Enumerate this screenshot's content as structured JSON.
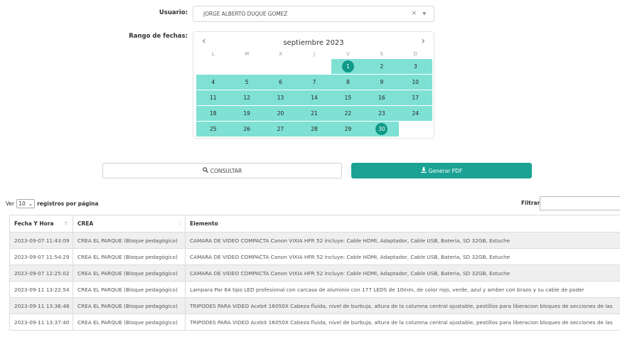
{
  "user_field": {
    "label": "Usuario:",
    "value": "JORGE ALBERTO DUQUE GOMEZ",
    "clear_icon": "close-icon",
    "caret_icon": "chevron-down-icon"
  },
  "date_range": {
    "label": "Rango de fechas:",
    "month_title": "septiembre 2023",
    "prev": "‹",
    "next": "›",
    "weekdays": [
      "L",
      "M",
      "X",
      "J",
      "V",
      "S",
      "D"
    ],
    "leading_blanks": 4,
    "days": [
      "1",
      "2",
      "3",
      "4",
      "5",
      "6",
      "7",
      "8",
      "9",
      "10",
      "11",
      "12",
      "13",
      "14",
      "15",
      "16",
      "17",
      "18",
      "19",
      "20",
      "21",
      "22",
      "23",
      "24",
      "25",
      "26",
      "27",
      "28",
      "29",
      "30"
    ],
    "range_start": "1",
    "range_end": "30"
  },
  "buttons": {
    "consult": "CONSULTAR",
    "consult_icon": "search-icon",
    "pdf": "Generar PDF",
    "pdf_icon": "download-icon"
  },
  "table_controls": {
    "show_prefix": "Ver",
    "page_size": "10",
    "show_suffix": "registros por página",
    "filter_label": "Filtrar"
  },
  "table": {
    "headers": [
      "Fecha Y Hora",
      "CREA",
      "Elemento"
    ],
    "rows": [
      [
        "2023-09-07 11:43:09",
        "CREA EL PARQUE (Bloque pedagógico)",
        "CAMARA DE VIDEO COMPACTA Canon VIXIA HFR 52 incluye: Cable HDMI, Adaptador, Cable USB, Bateria, SD 32GB, Estuche"
      ],
      [
        "2023-09-07 11:54:29",
        "CREA EL PARQUE (Bloque pedagógico)",
        "CAMARA DE VIDEO COMPACTA Canon VIXIA HFR 52 incluye: Cable HDMI, Adaptador, Cable USB, Bateria, SD 32GB, Estuche"
      ],
      [
        "2023-09-07 12:25:02",
        "CREA EL PARQUE (Bloque pedagógico)",
        "CAMARA DE VIDEO COMPACTA Canon VIXIA HFR 52 incluye: Cable HDMI, Adaptador, Cable USB, Bateria, SD 32GB, Estuche"
      ],
      [
        "2023-09-11 13:22:54",
        "CREA EL PARQUE (Bloque pedagógico)",
        "Lampara Par 64 tipo LED profesional con carcasa de aluminio con 177 LEDS de 10mm, de color rojo, verde, azul y amber con brazo y su cable de poder"
      ],
      [
        "2023-09-11 13:36:48",
        "CREA EL PARQUE (Bloque pedagógico)",
        "TRIPODES PARA VIDEO Acebit 16050X Cabeza fluida, nivel de burbuja, altura de la columna central ajustable, pestillos para liberacion bloques de secciones de las"
      ],
      [
        "2023-09-11 13:37:40",
        "CREA EL PARQUE (Bloque pedagógico)",
        "TRIPODES PARA VIDEO Acebit 16050X Cabeza fluida, nivel de burbuja, altura de la columna central ajustable, pestillos para liberacion bloques de secciones de las"
      ]
    ]
  }
}
